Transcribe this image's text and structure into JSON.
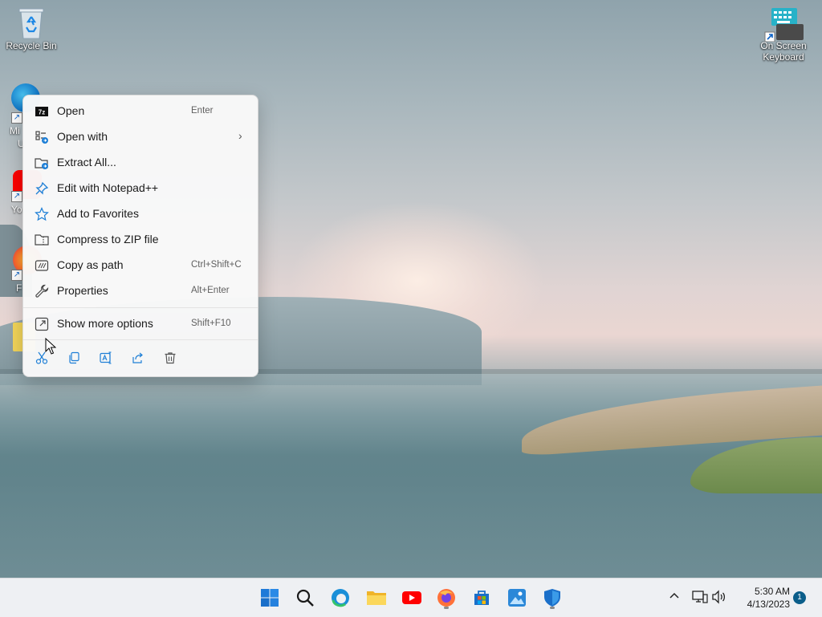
{
  "desktop": {
    "icons": [
      {
        "label": "Recycle Bin"
      },
      {
        "label": "On Screen Keyboard"
      }
    ],
    "partial_labels": [
      "Mi",
      "U",
      "Yo",
      "F"
    ]
  },
  "context_menu": {
    "items": [
      {
        "label": "Open",
        "shortcut": "Enter",
        "icon": "7zip-icon"
      },
      {
        "label": "Open with",
        "shortcut": "",
        "icon": "open-with-icon",
        "submenu": true
      },
      {
        "label": "Extract All...",
        "shortcut": "",
        "icon": "extract-icon"
      },
      {
        "label": "Edit with Notepad++",
        "shortcut": "",
        "icon": "pin-icon"
      },
      {
        "label": "Add to Favorites",
        "shortcut": "",
        "icon": "star-icon"
      },
      {
        "label": "Compress to ZIP file",
        "shortcut": "",
        "icon": "zip-icon"
      },
      {
        "label": "Copy as path",
        "shortcut": "Ctrl+Shift+C",
        "icon": "copy-path-icon"
      },
      {
        "label": "Properties",
        "shortcut": "Alt+Enter",
        "icon": "wrench-icon"
      }
    ],
    "more_options": {
      "label": "Show more options",
      "shortcut": "Shift+F10"
    },
    "quick_actions": [
      "cut-icon",
      "copy-icon",
      "rename-icon",
      "share-icon",
      "delete-icon"
    ],
    "submenu_glyph": "›"
  },
  "taskbar": {
    "apps": [
      "start",
      "search",
      "edge",
      "file-explorer",
      "youtube",
      "firefox",
      "microsoft-store",
      "photos",
      "windows-security"
    ],
    "clock": {
      "time": "5:30 AM",
      "date": "4/13/2023"
    },
    "notification_count": "1",
    "tray_chevron": "^"
  }
}
